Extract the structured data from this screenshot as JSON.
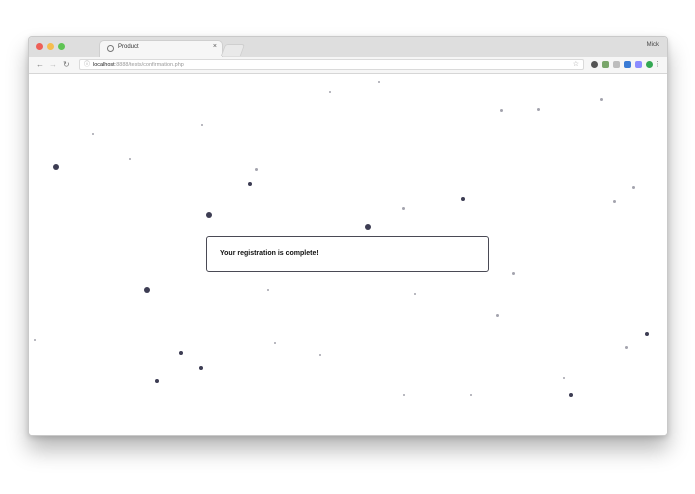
{
  "browser": {
    "tab_title": "Product",
    "tab_close": "×",
    "user_name": "Mick",
    "url_host": "localhost",
    "url_path": ":8888/tests/confirmation.php",
    "nav": {
      "back": "←",
      "forward": "→",
      "reload": "↻"
    },
    "lock_icon": "ⓘ",
    "star_icon": "☆",
    "menu_icon": "⋮",
    "traffic_colors": [
      "#ee5f57",
      "#f5bd4f",
      "#5fc454"
    ],
    "extension_colors": [
      "#555555",
      "#7aa66b",
      "#bdbdbd",
      "#3a7bd5",
      "#8c8cff",
      "#9a9a9a",
      "#34a853"
    ]
  },
  "page": {
    "message": "Your registration is complete!",
    "dot_color": "#33334a"
  }
}
